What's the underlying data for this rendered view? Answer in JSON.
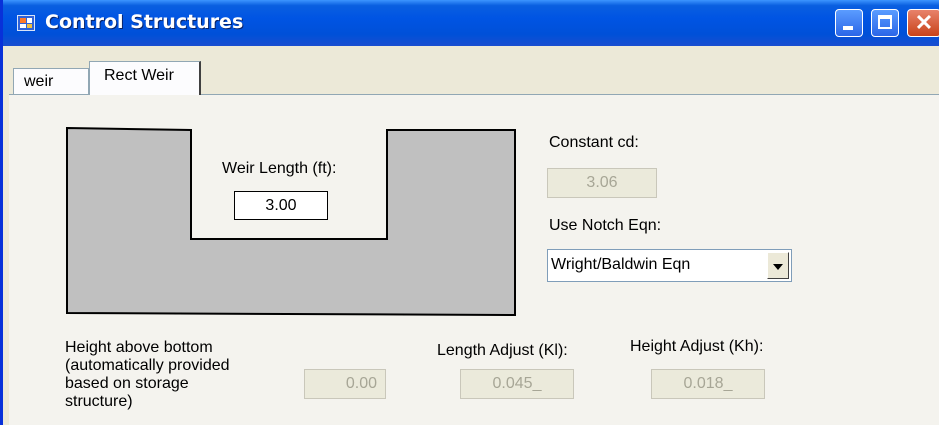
{
  "window": {
    "title": "Control Structures",
    "icon": "app-window-icon",
    "controls": [
      "minimize-icon",
      "maximize-icon",
      "close-icon"
    ]
  },
  "tabs": [
    {
      "label": "weir",
      "active": false
    },
    {
      "label": "Rect Weir",
      "active": true
    }
  ],
  "weir_length": {
    "label": "Weir Length (ft):",
    "value": "3.00"
  },
  "constant_cd": {
    "label": "Constant cd:",
    "value": "3.06"
  },
  "notch_eqn": {
    "label": "Use Notch Eqn:",
    "selected": "Wright/Baldwin Eqn"
  },
  "height_above_bottom": {
    "label_lines": [
      "Height above bottom",
      "(automatically provided",
      "based on storage",
      "structure)"
    ],
    "value": "0.00"
  },
  "length_adjust": {
    "label": "Length Adjust (Kl):",
    "value": "0.045_"
  },
  "height_adjust": {
    "label": "Height Adjust (Kh):",
    "value": "0.018_"
  },
  "colors": {
    "titlebar": "#0054e3",
    "weir_fill": "#c0c0c0",
    "window_bg": "#ece9d8"
  }
}
